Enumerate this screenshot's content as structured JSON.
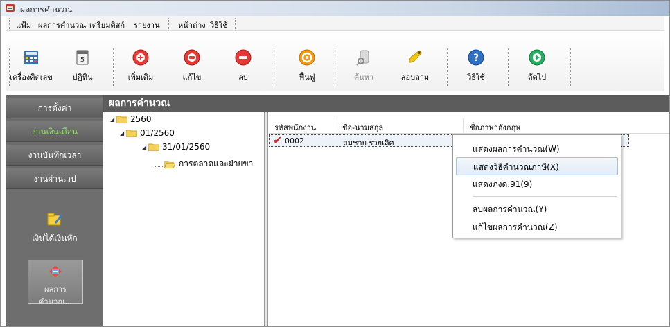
{
  "window": {
    "title": "ผลการคำนวณ"
  },
  "menubar": {
    "items": [
      {
        "label": "แฟ้ม"
      },
      {
        "label": "ผลการคำนวณ"
      },
      {
        "label": "เตรียมดิสก์"
      },
      {
        "label": "รายงาน"
      },
      {
        "label": "หน้าต่าง"
      },
      {
        "label": "วิธีใช้"
      }
    ]
  },
  "toolbar": {
    "buttons": [
      {
        "label": "เครื่องคิดเลข",
        "icon": "calculator-icon"
      },
      {
        "label": "ปฏิทิน",
        "icon": "calendar-icon"
      },
      {
        "label": "เพิ่มเติม",
        "icon": "add-icon"
      },
      {
        "label": "แก้ไข",
        "icon": "edit-icon"
      },
      {
        "label": "ลบ",
        "icon": "delete-icon"
      },
      {
        "label": "ฟื้นฟู",
        "icon": "restore-icon"
      },
      {
        "label": "ค้นหา",
        "icon": "search-icon",
        "disabled": true
      },
      {
        "label": "สอบถาม",
        "icon": "inquire-icon"
      },
      {
        "label": "วิธีใช้",
        "icon": "help-icon"
      },
      {
        "label": "ถัดไป",
        "icon": "next-icon"
      }
    ]
  },
  "leftnav": {
    "items": [
      {
        "label": "การตั้งค่า"
      },
      {
        "label": "งานเงินเดือน",
        "active": true
      },
      {
        "label": "งานบันทึกเวลา"
      },
      {
        "label": "งานผ่านเวป"
      }
    ],
    "panel_items": [
      {
        "label": "เงินได้เงินหัก",
        "icon": "income-deduction-icon"
      },
      {
        "label": "ผลการ\nคำนวณ...",
        "icon": "calc-result-icon",
        "selected": true
      }
    ],
    "selected_label_line1": "ผลการ",
    "selected_label_line2": "คำนวณ..."
  },
  "content": {
    "header": "ผลการคำนวณ",
    "tree": [
      {
        "label": "2560",
        "level": 0
      },
      {
        "label": "01/2560",
        "level": 1
      },
      {
        "label": "31/01/2560",
        "level": 2
      },
      {
        "label": "การตลาดและฝ่ายขา",
        "level": 3
      }
    ],
    "grid": {
      "columns": [
        "รหัสพนักงาน",
        "ชื่อ-นามสกุล",
        "ชื่อภาษาอังกฤษ"
      ],
      "rows": [
        {
          "code": "0002",
          "name": "สมชาย รวยเลิศ",
          "english_name": ""
        }
      ]
    }
  },
  "context_menu": {
    "items": [
      {
        "label": "แสดงผลการคำนวณ(W)"
      },
      {
        "label": "แสดงวิธีคำนวณภาษี(X)",
        "hover": true
      },
      {
        "label": "แสดงภงด.91(9)"
      },
      {
        "label": "ลบผลการคำนวณ(Y)"
      },
      {
        "label": "แก้ไขผลการคำนวณ(Z)"
      }
    ]
  },
  "colors": {
    "header_bg": "#5c5c5c",
    "nav_active_text": "#8edc5a",
    "check_red": "#d91e1e"
  }
}
